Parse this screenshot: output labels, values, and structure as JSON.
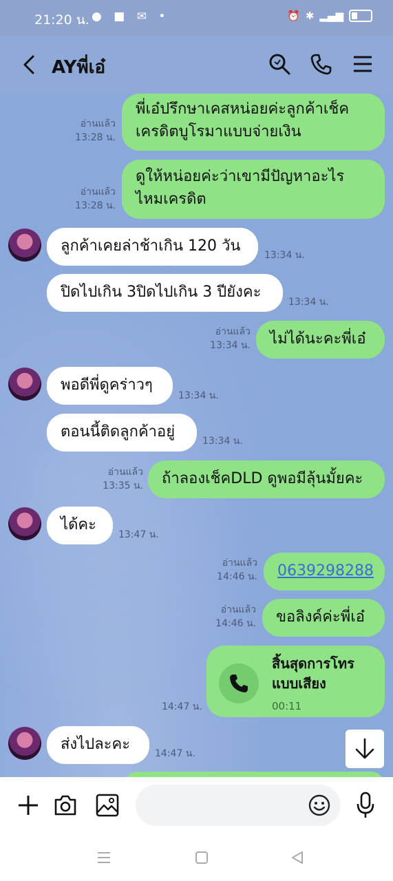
{
  "status": {
    "time": "21:20 น."
  },
  "header": {
    "title": "AYพี่เอ๋"
  },
  "messages": [
    {
      "dir": "out",
      "lines": [
        "พี่เอ๋ปรึกษาเคสหน่อยค่ะลูกค้าเช็ค",
        "เครดิตบูโรมาแบบจ่ายเงิน"
      ],
      "read": "อ่านแล้ว",
      "time": "13:28 น."
    },
    {
      "dir": "out",
      "lines": [
        "ดูให้หน่อยค่ะว่าเขามีปัญหาอะไร",
        "ไหมเครดิต"
      ],
      "read": "อ่านแล้ว",
      "time": "13:28 น."
    },
    {
      "dir": "in",
      "text": "ลูกค้าเคยล่าช้าเกิน 120 วัน",
      "time": "13:34 น."
    },
    {
      "dir": "in",
      "text": "ปิดไปเกิน 3ปิดไปเกิน 3 ปียังคะ",
      "time": "13:34 น."
    },
    {
      "dir": "out",
      "text": "ไม่ได้นะคะพี่เอ๋",
      "read": "อ่านแล้ว",
      "time": "13:34 น."
    },
    {
      "dir": "in",
      "text": "พอดีพี่ดูคร่าวๆ",
      "time": "13:34 น."
    },
    {
      "dir": "in",
      "text": "ตอนนี้ติดลูกค้าอยู่",
      "time": "13:34 น."
    },
    {
      "dir": "out",
      "text": "ถ้าลองเช็คDLD ดูพอมีลุ้นมั้ยคะ",
      "read": "อ่านแล้ว",
      "time": "13:35 น."
    },
    {
      "dir": "in",
      "text": "ได้คะ",
      "time": "13:47 น."
    },
    {
      "dir": "out",
      "text": "0639298288",
      "read": "อ่านแล้ว",
      "time": "14:46 น."
    },
    {
      "dir": "out",
      "text": "ขอลิงค์ค่ะพี่เอ๋",
      "read": "อ่านแล้ว",
      "time": "14:46 น."
    },
    {
      "dir": "out",
      "call_title": [
        "สิ้นสุดการโทร",
        "แบบเสียง"
      ],
      "call_duration": "00:11",
      "time": "14:47 น."
    },
    {
      "dir": "in",
      "text": "ส่งไปละคะ",
      "time": "14:47 น."
    }
  ],
  "colors": {
    "outgoing": "#8fe286",
    "incoming": "#ffffff",
    "background": "#8fa9d8"
  },
  "icons": [
    "back-icon",
    "search-icon",
    "phone-icon",
    "menu-icon",
    "plus-icon",
    "camera-icon",
    "image-icon",
    "emoji-icon",
    "mic-icon",
    "arrow-down-icon"
  ]
}
